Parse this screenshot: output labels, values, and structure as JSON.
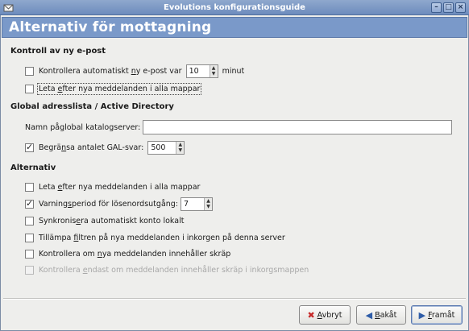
{
  "window": {
    "title": "Evolutions konfigurationsguide"
  },
  "page": {
    "title": "Alternativ för mottagning"
  },
  "sections": {
    "new_mail": {
      "heading": "Kontroll av ny e-post"
    },
    "gal": {
      "heading": "Global adresslista / Active Directory"
    },
    "options": {
      "heading": "Alternativ"
    }
  },
  "new_mail": {
    "auto_check": {
      "label_before": "Kontrollera automatiskt ",
      "mnemonic": "n",
      "label_mid": "y e-post var",
      "checked": false,
      "value": "10",
      "unit": "minut"
    },
    "check_all_folders": {
      "label_before": "Leta ",
      "mnemonic": "e",
      "label_after": "fter nya meddelanden i alla mappar",
      "checked": false
    }
  },
  "gal": {
    "server_label_before": "Namn på ",
    "server_mnemonic": "g",
    "server_label_after": "lobal katalogserver:",
    "server_value": "",
    "limit": {
      "label_before": "Begrä",
      "mnemonic": "n",
      "label_after": "sa antalet GAL-svar:",
      "checked": true,
      "value": "500"
    }
  },
  "options": {
    "items": [
      {
        "before": "Leta ",
        "mnemonic": "e",
        "after": "fter nya meddelanden i alla mappar",
        "checked": false,
        "disabled": false
      },
      {
        "before": "Varning",
        "mnemonic": "s",
        "after": "period för lösenordsutgång:",
        "checked": true,
        "disabled": false,
        "spin_value": "7"
      },
      {
        "before": "Synkronis",
        "mnemonic": "e",
        "after": "ra automatiskt konto lokalt",
        "checked": false,
        "disabled": false
      },
      {
        "before": "Tillämpa ",
        "mnemonic": "f",
        "after": "iltren på nya meddelanden i inkorgen på denna server",
        "checked": false,
        "disabled": false
      },
      {
        "before": "Kontrollera om ",
        "mnemonic": "n",
        "after": "ya meddelanden innehåller skräp",
        "checked": false,
        "disabled": false
      },
      {
        "before": "Kontrollera ",
        "mnemonic": "e",
        "after": "ndast om meddelanden innehåller skräp i inkorgsmappen",
        "checked": false,
        "disabled": true
      }
    ]
  },
  "buttons": {
    "cancel": {
      "mnemonic": "A",
      "rest": "vbryt"
    },
    "back": {
      "mnemonic": "B",
      "rest": "akåt"
    },
    "forward": {
      "mnemonic": "F",
      "rest": "ramåt"
    }
  },
  "colors": {
    "header_bg": "#7a99c9",
    "titlebar": "#7d98c5"
  }
}
